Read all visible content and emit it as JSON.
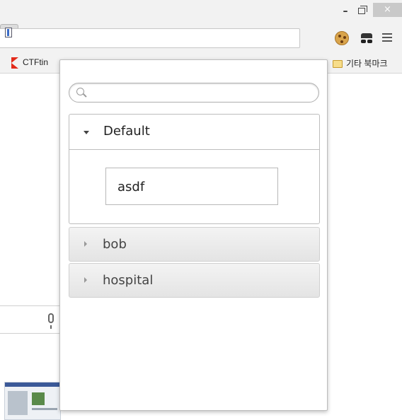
{
  "window": {
    "minimize_glyph": "–",
    "close_glyph": "×"
  },
  "toolbar": {
    "extension_icons": [
      "bookmark-doc-icon",
      "cookie-icon",
      "incognito-icon",
      "menu-icon"
    ]
  },
  "bookmarks_bar": {
    "items": [
      {
        "label": "CTFtin",
        "icon": "ctftime-logo-icon"
      },
      {
        "label": "기타 북마크",
        "icon": "folder-icon"
      }
    ]
  },
  "popup": {
    "search": {
      "placeholder": "",
      "value": ""
    },
    "groups": [
      {
        "name": "Default",
        "expanded": true,
        "items": [
          "asdf"
        ]
      },
      {
        "name": "bob",
        "expanded": false,
        "items": []
      },
      {
        "name": "hospital",
        "expanded": false,
        "items": []
      }
    ]
  }
}
